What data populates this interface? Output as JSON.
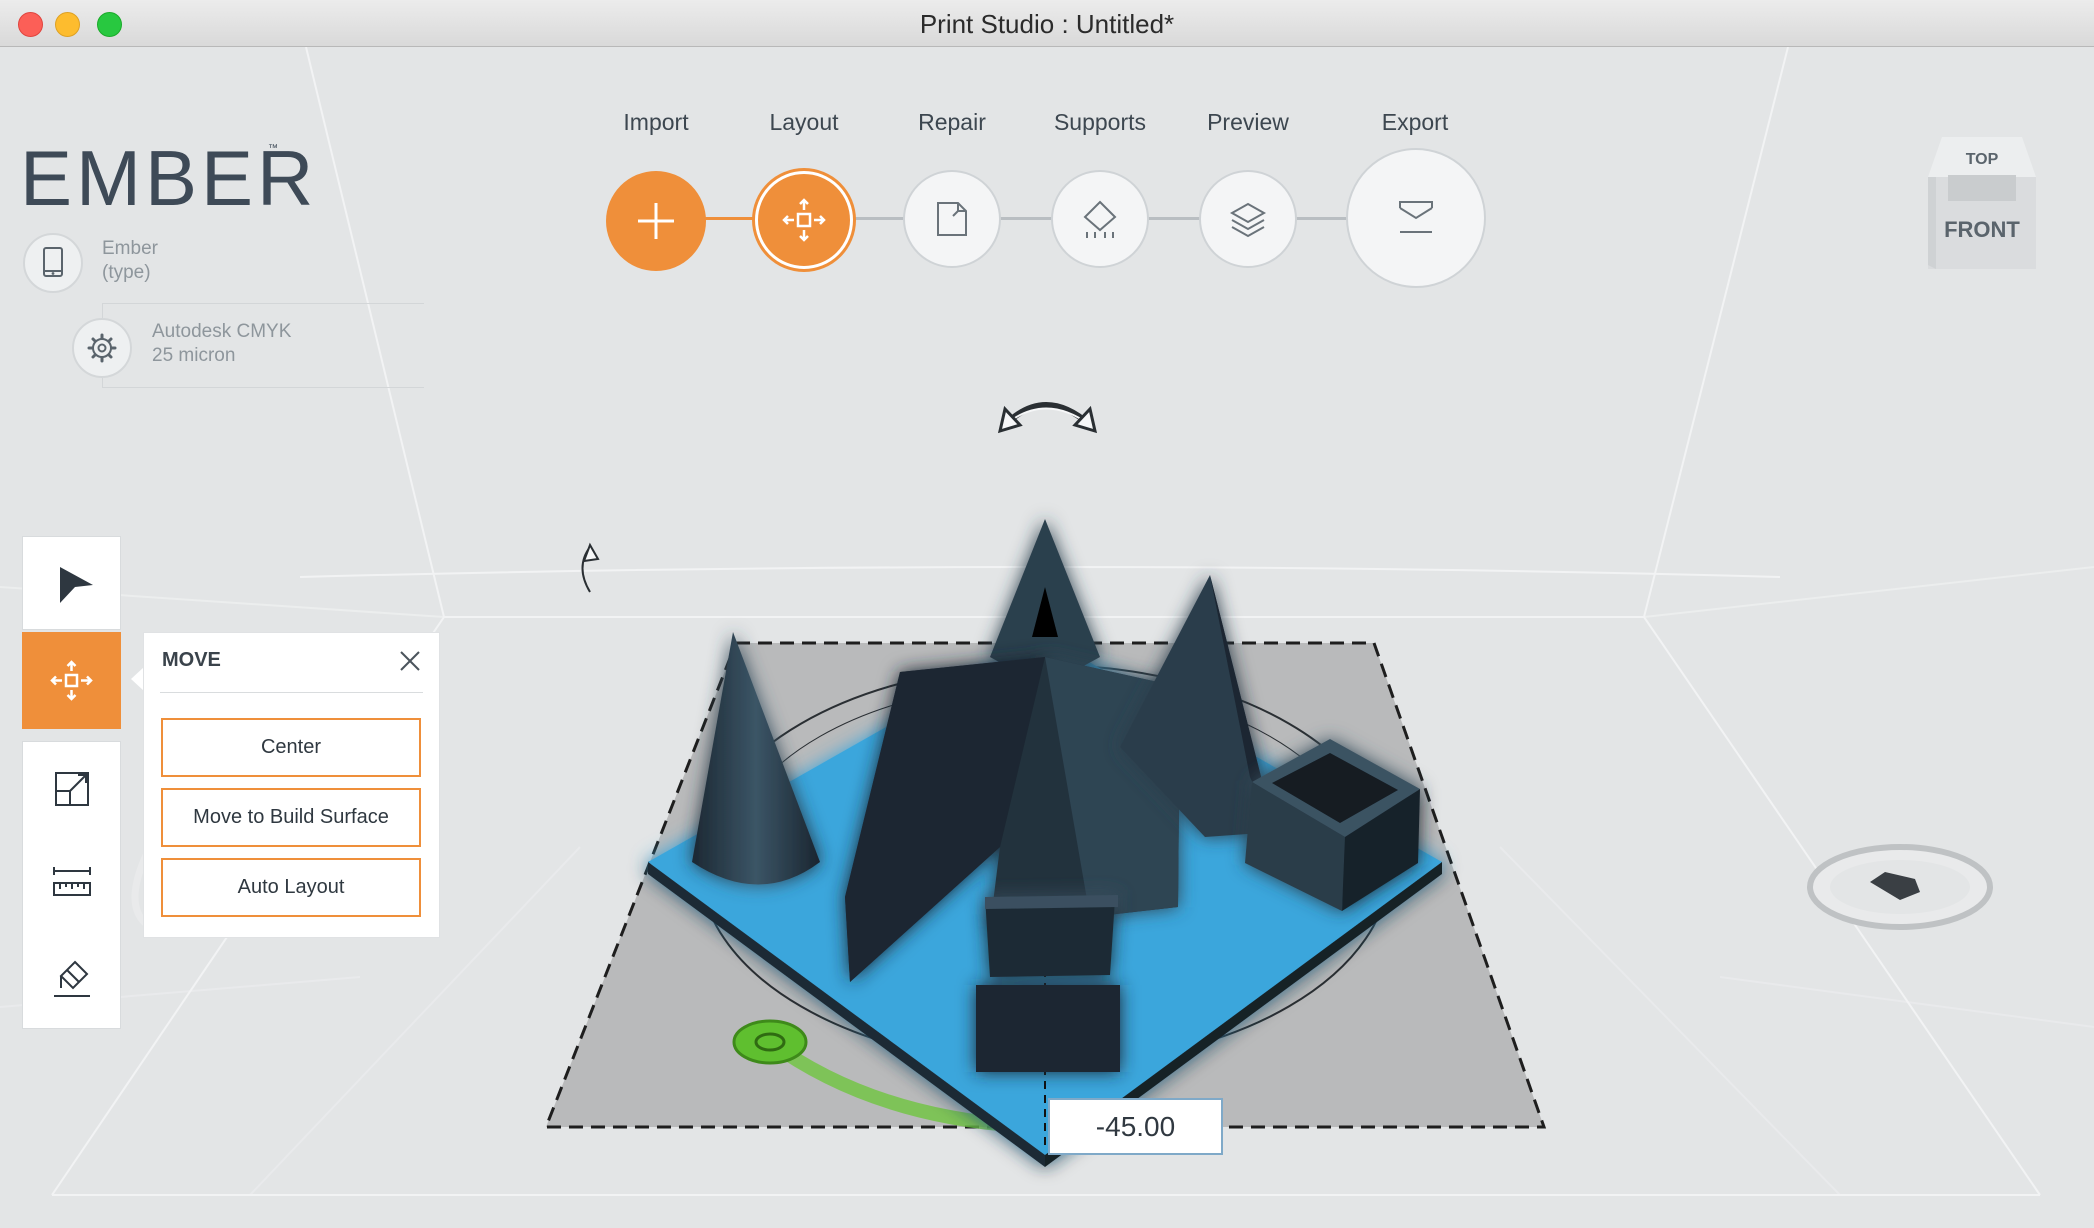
{
  "window": {
    "title": "Print Studio : Untitled*"
  },
  "brand": {
    "logo_text": "EMBER",
    "trademark": "™"
  },
  "printer": {
    "name": "Ember",
    "type": "(type)",
    "icon": "tablet-icon"
  },
  "material": {
    "name": "Autodesk CMYK",
    "layer": "25 micron",
    "icon": "gear-icon"
  },
  "workflow": {
    "active_step": "Layout",
    "steps": [
      {
        "label": "Import",
        "icon": "plus-icon",
        "state": "done"
      },
      {
        "label": "Layout",
        "icon": "move-arrows-icon",
        "state": "active"
      },
      {
        "label": "Repair",
        "icon": "repair-icon",
        "state": "pending"
      },
      {
        "label": "Supports",
        "icon": "supports-icon",
        "state": "pending"
      },
      {
        "label": "Preview",
        "icon": "layers-icon",
        "state": "pending"
      },
      {
        "label": "Export",
        "icon": "export-tray-icon",
        "state": "pending"
      }
    ]
  },
  "view_cube": {
    "top_label": "TOP",
    "front_label": "FRONT"
  },
  "tools": [
    {
      "name": "select",
      "icon": "pointer-arrow-icon"
    },
    {
      "name": "move",
      "icon": "move-arrows-icon",
      "active": true
    },
    {
      "name": "scale",
      "icon": "scale-icon"
    },
    {
      "name": "measure",
      "icon": "ruler-icon"
    },
    {
      "name": "paint",
      "icon": "eraser-icon"
    }
  ],
  "move_panel": {
    "title": "MOVE",
    "buttons": {
      "center": "Center",
      "move_to_build": "Move to Build Surface",
      "auto_layout": "Auto Layout"
    }
  },
  "rotation": {
    "angle_value": "-45.00"
  },
  "colors": {
    "accent": "#ef8f3a",
    "model_blue": "#3aa6dc",
    "model_dark": "#23313d",
    "rotation_green": "#5fc832",
    "background": "#e3e5e6"
  }
}
